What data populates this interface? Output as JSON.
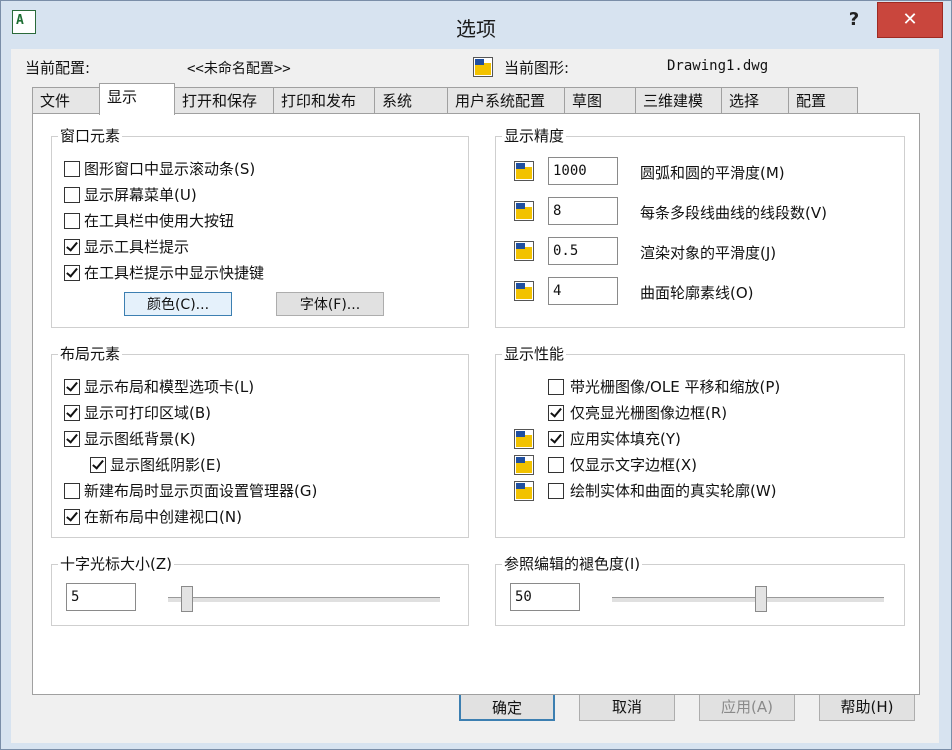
{
  "window": {
    "title": "选项",
    "help": "?",
    "close": "✕",
    "app_icon": "A"
  },
  "header": {
    "profile_label": "当前配置:",
    "profile_value": "<<未命名配置>>",
    "drawing_label": "当前图形:",
    "drawing_value": "Drawing1.dwg"
  },
  "tabs": [
    "文件",
    "显示",
    "打开和保存",
    "打印和发布",
    "系统",
    "用户系统配置",
    "草图",
    "三维建模",
    "选择",
    "配置"
  ],
  "active_tab": "显示",
  "window_elements": {
    "title": "窗口元素",
    "items": [
      {
        "label": "图形窗口中显示滚动条(S)",
        "checked": false
      },
      {
        "label": "显示屏幕菜单(U)",
        "checked": false
      },
      {
        "label": "在工具栏中使用大按钮",
        "checked": false
      },
      {
        "label": "显示工具栏提示",
        "checked": true
      },
      {
        "label": "在工具栏提示中显示快捷键",
        "checked": true
      }
    ],
    "colors_button": "颜色(C)...",
    "fonts_button": "字体(F)..."
  },
  "display_resolution": {
    "title": "显示精度",
    "items": [
      {
        "value": "1000",
        "label": "圆弧和圆的平滑度(M)"
      },
      {
        "value": "8",
        "label": "每条多段线曲线的线段数(V)"
      },
      {
        "value": "0.5",
        "label": "渲染对象的平滑度(J)"
      },
      {
        "value": "4",
        "label": "曲面轮廓素线(O)"
      }
    ]
  },
  "layout_elements": {
    "title": "布局元素",
    "items": [
      {
        "label": "显示布局和模型选项卡(L)",
        "checked": true
      },
      {
        "label": "显示可打印区域(B)",
        "checked": true
      },
      {
        "label": "显示图纸背景(K)",
        "checked": true
      },
      {
        "label": "显示图纸阴影(E)",
        "checked": true
      },
      {
        "label": "新建布局时显示页面设置管理器(G)",
        "checked": false
      },
      {
        "label": "在新布局中创建视口(N)",
        "checked": true
      }
    ]
  },
  "display_performance": {
    "title": "显示性能",
    "items": [
      {
        "label": "带光栅图像/OLE 平移和缩放(P)",
        "checked": false
      },
      {
        "label": "仅亮显光栅图像边框(R)",
        "checked": true
      },
      {
        "label": "应用实体填充(Y)",
        "checked": true
      },
      {
        "label": "仅显示文字边框(X)",
        "checked": false
      },
      {
        "label": "绘制实体和曲面的真实轮廓(W)",
        "checked": false
      }
    ]
  },
  "crosshair": {
    "title": "十字光标大小(Z)",
    "value": "5",
    "slider_fraction": 0.05
  },
  "xref_fade": {
    "title": "参照编辑的褪色度(I)",
    "value": "50",
    "slider_fraction": 0.55
  },
  "footer": {
    "ok": "确定",
    "cancel": "取消",
    "apply": "应用(A)",
    "help": "帮助(H)"
  }
}
